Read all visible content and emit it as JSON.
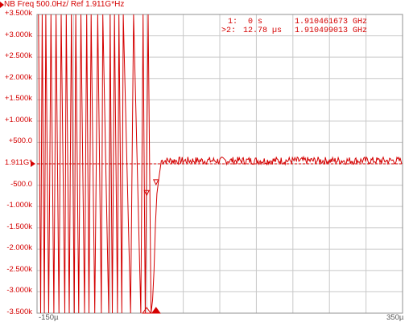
{
  "title": "NB Freq 500.0Hz/ Ref 1.911G*Hz",
  "ref_label": "1.911G*",
  "markers": [
    {
      "id": "1:",
      "time": "0 s",
      "freq": "1.910461673 GHz"
    },
    {
      "id": ">2:",
      "time": "12.78 µs",
      "freq": "1.910499013 GHz"
    }
  ],
  "colors": {
    "trace": "#d40000",
    "grid": "#c8c8c8",
    "frame": "#909090",
    "background": "#ffffff"
  },
  "chart_data": {
    "type": "line",
    "title": "NB Freq 500.0Hz/ Ref 1.911G*Hz",
    "xlabel": "",
    "ylabel": "",
    "x_tick_labels": [
      "-150µ",
      "350µ"
    ],
    "y_tick_labels": [
      "+3.500k",
      "+3.000k",
      "+2.500k",
      "+2.000k",
      "+1.500k",
      "+1.000k",
      "+500.0",
      "1.911G*",
      "-500.0",
      "-1.000k",
      "-1.500k",
      "-2.000k",
      "-2.500k",
      "-3.000k",
      "-3.500k"
    ],
    "xlim": [
      -150,
      350
    ],
    "ylim": [
      -3500,
      3500
    ],
    "x_unit": "µs",
    "y_unit": "Hz offset from 1.911 GHz",
    "grid": true,
    "reference_y": 0,
    "series": [
      {
        "x": [
          -148,
          -145,
          -143,
          -140,
          -138,
          -134,
          -131,
          -127,
          -124,
          -120,
          -117,
          -112,
          -110,
          -106,
          -103,
          -99,
          -97,
          -93,
          -90,
          -85,
          -82,
          -79,
          -76,
          -71,
          -67,
          -62,
          -60,
          -52,
          -50,
          -47,
          -44,
          -40,
          -38,
          -34,
          -32,
          -22,
          -18,
          -8,
          -5,
          -2,
          2,
          6,
          8,
          10,
          12,
          14,
          17,
          20,
          23,
          26,
          30,
          40,
          60,
          80,
          100,
          120,
          140,
          160,
          180,
          200,
          220,
          240,
          260,
          280,
          300,
          320,
          340,
          350
        ],
        "y": [
          3500,
          -3500,
          3500,
          -3500,
          3500,
          -3500,
          3500,
          -3500,
          3500,
          -3500,
          3500,
          -3500,
          3500,
          -3500,
          3500,
          -3500,
          3500,
          -3500,
          3500,
          -3500,
          3500,
          -3500,
          3500,
          -3500,
          3500,
          -3500,
          3500,
          -3500,
          3500,
          -3500,
          3500,
          -3500,
          3500,
          -3500,
          3500,
          -3500,
          3500,
          -3500,
          3500,
          -3500,
          3500,
          -3500,
          -3200,
          -2500,
          -1400,
          -700,
          -300,
          50,
          150,
          40,
          110,
          60,
          90,
          40,
          110,
          70,
          30,
          100,
          80,
          60,
          40,
          110,
          70,
          30,
          90,
          60,
          90,
          70
        ]
      }
    ],
    "markers": [
      {
        "label": "1",
        "x": 0
      },
      {
        "label": "2",
        "x": 12.78
      }
    ]
  }
}
